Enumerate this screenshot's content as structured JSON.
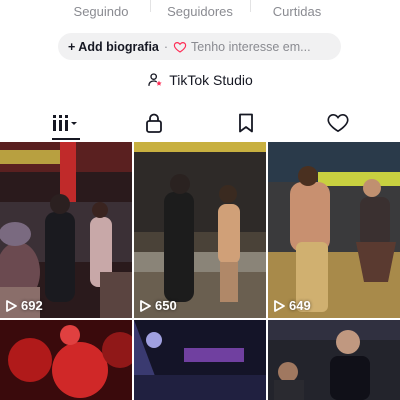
{
  "stats": {
    "following_label": "Seguindo",
    "followers_label": "Seguidores",
    "likes_label": "Curtidas"
  },
  "bio": {
    "add_label": "Adicionar biografia",
    "add_visible": "+ Add biografia",
    "interest_label": "Tenho interesse em..."
  },
  "studio": {
    "label": "TikTok Studio"
  },
  "tabs": [
    {
      "name": "videos",
      "icon": "grid-icon"
    },
    {
      "name": "private",
      "icon": "lock-icon"
    },
    {
      "name": "saved",
      "icon": "bookmark-icon"
    },
    {
      "name": "liked",
      "icon": "heart-icon"
    }
  ],
  "videos": [
    {
      "views": "692"
    },
    {
      "views": "650"
    },
    {
      "views": "649"
    },
    {
      "views": ""
    },
    {
      "views": ""
    },
    {
      "views": ""
    }
  ],
  "colors": {
    "text": "#161823",
    "muted": "#8a8b91",
    "pill_bg": "#f1f1f2",
    "heart_accent": "#fe2c55"
  }
}
